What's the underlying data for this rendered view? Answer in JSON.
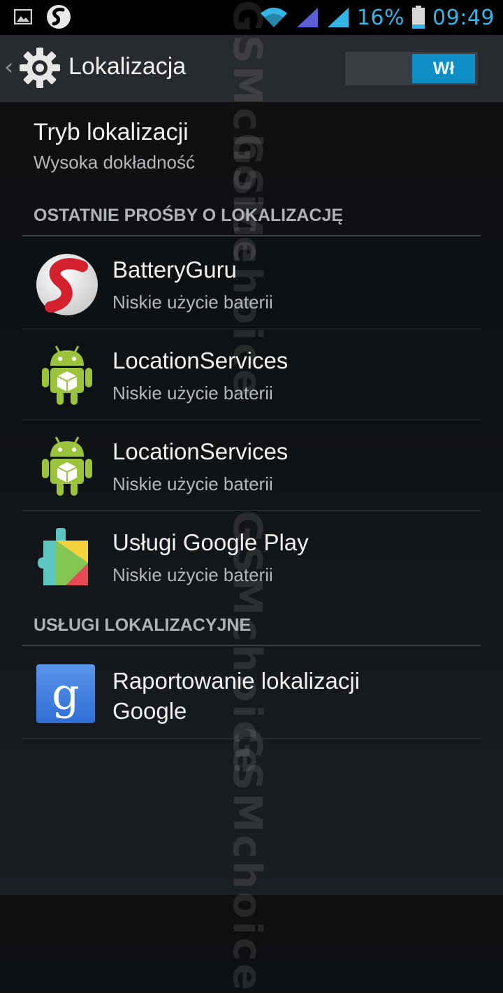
{
  "status_bar": {
    "battery_percent": "16%",
    "time": "09:49",
    "icons": [
      "picture-icon",
      "snapdragon-icon",
      "wifi-icon",
      "signal-icon",
      "signal-icon",
      "battery-icon"
    ],
    "accent": "#33b5e5"
  },
  "action_bar": {
    "title": "Lokalizacja",
    "toggle_label": "Wł",
    "toggle_state": "on",
    "toggle_color": "#0f8ec5"
  },
  "location_mode": {
    "title": "Tryb lokalizacji",
    "value": "Wysoka dokładność"
  },
  "recent_requests": {
    "header": "OSTATNIE PROŚBY O LOKALIZACJĘ",
    "items": [
      {
        "name": "BatteryGuru",
        "usage": "Niskie użycie baterii",
        "icon": "snapdragon-app-icon"
      },
      {
        "name": "LocationServices",
        "usage": "Niskie użycie baterii",
        "icon": "android-app-icon"
      },
      {
        "name": "LocationServices",
        "usage": "Niskie użycie baterii",
        "icon": "android-app-icon"
      },
      {
        "name": "Usługi Google Play",
        "usage": "Niskie użycie baterii",
        "icon": "google-play-services-icon"
      }
    ]
  },
  "location_services": {
    "header": "USŁUGI LOKALIZACYJNE",
    "items": [
      {
        "name": "Raportowanie lokalizacji Google",
        "icon": "google-settings-icon"
      }
    ]
  },
  "watermark": "GSMchoice"
}
